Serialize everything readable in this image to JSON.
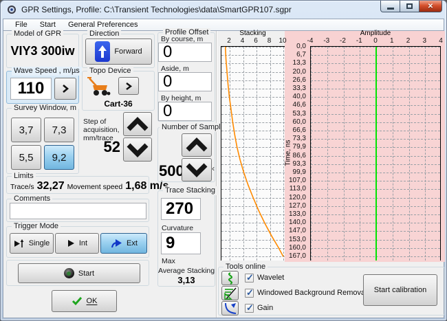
{
  "window": {
    "title": "GPR Settings, Profile: C:\\Transient Technologies\\data\\SmartGPR107.sgpr"
  },
  "menu": {
    "items": [
      "File",
      "Start",
      "General Preferences"
    ]
  },
  "left": {
    "model": {
      "label": "Model of GPR",
      "value": "VIY3 300iw"
    },
    "wave_speed": {
      "label": "Wave Speed , m/µs",
      "value": "110"
    },
    "survey_window": {
      "label": "Survey Window, m",
      "options": [
        "3,7",
        "7,3",
        "5,5",
        "9,2"
      ],
      "selected": "9,2"
    },
    "limits": {
      "label": "Limits",
      "trace_label": "Trace/s",
      "trace_value": "32,27",
      "speed_label": "Movement speed",
      "speed_value": "1,68 m/s"
    },
    "comments": {
      "label": "Comments",
      "value": ""
    },
    "trigger_mode": {
      "label": "Trigger Mode",
      "options": [
        "Single",
        "Int",
        "Ext"
      ],
      "selected": "Ext"
    },
    "start_label": "Start",
    "ok_label": "OK"
  },
  "direction": {
    "label": "Direction",
    "button_label": "Forward"
  },
  "topo_device": {
    "label": "Topo Device",
    "device": "Cart-36"
  },
  "step_acquisition": {
    "label": "Step of acquisition, mm/trace",
    "value": "52"
  },
  "profile_offset": {
    "label": "Profile Offset",
    "fields": [
      {
        "label": "By course, m",
        "value": "0"
      },
      {
        "label": "Aside, m",
        "value": "0"
      },
      {
        "label": "By height, m",
        "value": "0"
      }
    ]
  },
  "number_of_samples": {
    "label": "Number of Samples",
    "value": "500"
  },
  "stacking_group": {
    "label": "Trace Stacking",
    "trace_stacking": "270",
    "curvature_label": "Curvature",
    "curvature": "9",
    "max_label": "Max",
    "average_label": "Average Stacking",
    "average_value": "3,13"
  },
  "plots": {
    "stacking": {
      "title": "Stacking",
      "x_ticks": [
        2,
        4,
        6,
        8,
        10
      ],
      "curve_color": "#FF8A00",
      "curve_points": [
        [
          0,
          1.35
        ],
        [
          10,
          1.45
        ],
        [
          20,
          1.6
        ],
        [
          30,
          1.75
        ],
        [
          40,
          1.95
        ],
        [
          50,
          2.2
        ],
        [
          60,
          2.45
        ],
        [
          70,
          2.75
        ],
        [
          80,
          3.1
        ],
        [
          90,
          3.55
        ],
        [
          100,
          4.1
        ],
        [
          110,
          4.75
        ],
        [
          120,
          5.5
        ],
        [
          130,
          6.3
        ],
        [
          140,
          7.2
        ],
        [
          150,
          8.2
        ],
        [
          160,
          9.3
        ],
        [
          167,
          10
        ]
      ]
    },
    "amplitude": {
      "title": "Amplitude",
      "x_ticks": [
        -4,
        -3,
        -2,
        -1,
        0,
        1,
        2,
        3,
        4
      ],
      "zero_line_color": "#00E400",
      "background": "#F8D2D2"
    },
    "time_axis": {
      "label": "Time, ns",
      "tick_labels": [
        "0,0",
        "6,7",
        "13,3",
        "20,0",
        "26,6",
        "33,3",
        "40,0",
        "46,6",
        "53,3",
        "60,0",
        "66,6",
        "73,3",
        "79,9",
        "86,6",
        "93,3",
        "99,9",
        "107,0",
        "113,0",
        "120,0",
        "127,0",
        "133,0",
        "140,0",
        "147,0",
        "153,0",
        "160,0",
        "167,0"
      ]
    }
  },
  "tools": {
    "label": "Tools online",
    "items": [
      {
        "icon": "wavelet-icon",
        "label": "Wavelet",
        "checked": true
      },
      {
        "icon": "background-removal-icon",
        "label": "Windowed Background Removal",
        "checked": true
      },
      {
        "icon": "gain-icon",
        "label": "Gain",
        "checked": true
      }
    ],
    "calibration_label": "Start calibration"
  },
  "colors": {
    "selection_blue": "#71B6DF",
    "chart_pink": "#F8D2D2",
    "curve_orange": "#FF8A00",
    "zero_green": "#00E400"
  }
}
